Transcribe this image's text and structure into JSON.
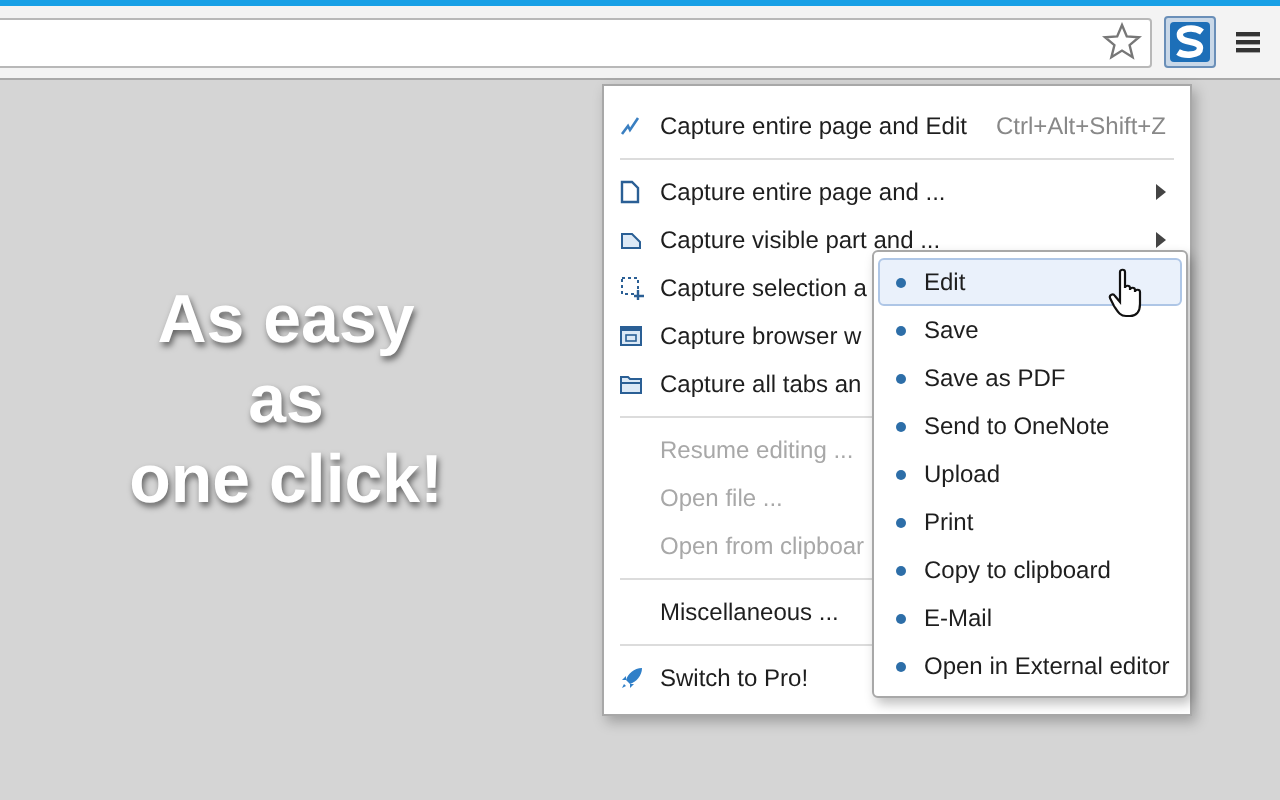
{
  "headline_lines": [
    "As easy",
    "as",
    "one click!"
  ],
  "menu": {
    "groups": [
      [
        {
          "label": "Capture entire page and Edit",
          "shortcut": "Ctrl+Alt+Shift+Z",
          "disabled": false
        }
      ],
      [
        {
          "label": "Capture entire page and ...",
          "disabled": false,
          "submenu": true
        },
        {
          "label": "Capture visible part and ...",
          "disabled": false,
          "submenu": true
        },
        {
          "label": "Capture selection a",
          "disabled": false
        },
        {
          "label": "Capture browser w",
          "disabled": false
        },
        {
          "label": "Capture all tabs an",
          "disabled": false
        }
      ],
      [
        {
          "label": "Resume editing ...",
          "disabled": true
        },
        {
          "label": "Open file ...",
          "disabled": true
        },
        {
          "label": "Open from clipboar",
          "disabled": true
        }
      ],
      [
        {
          "label": "Miscellaneous ...",
          "disabled": false
        }
      ],
      [
        {
          "label": "Switch to Pro!",
          "disabled": false
        }
      ]
    ]
  },
  "submenu": {
    "items": [
      {
        "label": "Edit",
        "highlighted": true
      },
      {
        "label": "Save",
        "highlighted": false
      },
      {
        "label": "Save as PDF",
        "highlighted": false
      },
      {
        "label": "Send to OneNote",
        "highlighted": false
      },
      {
        "label": "Upload",
        "highlighted": false
      },
      {
        "label": "Print",
        "highlighted": false
      },
      {
        "label": "Copy to clipboard",
        "highlighted": false
      },
      {
        "label": "E-Mail",
        "highlighted": false
      },
      {
        "label": "Open in External editor",
        "highlighted": false
      }
    ]
  }
}
